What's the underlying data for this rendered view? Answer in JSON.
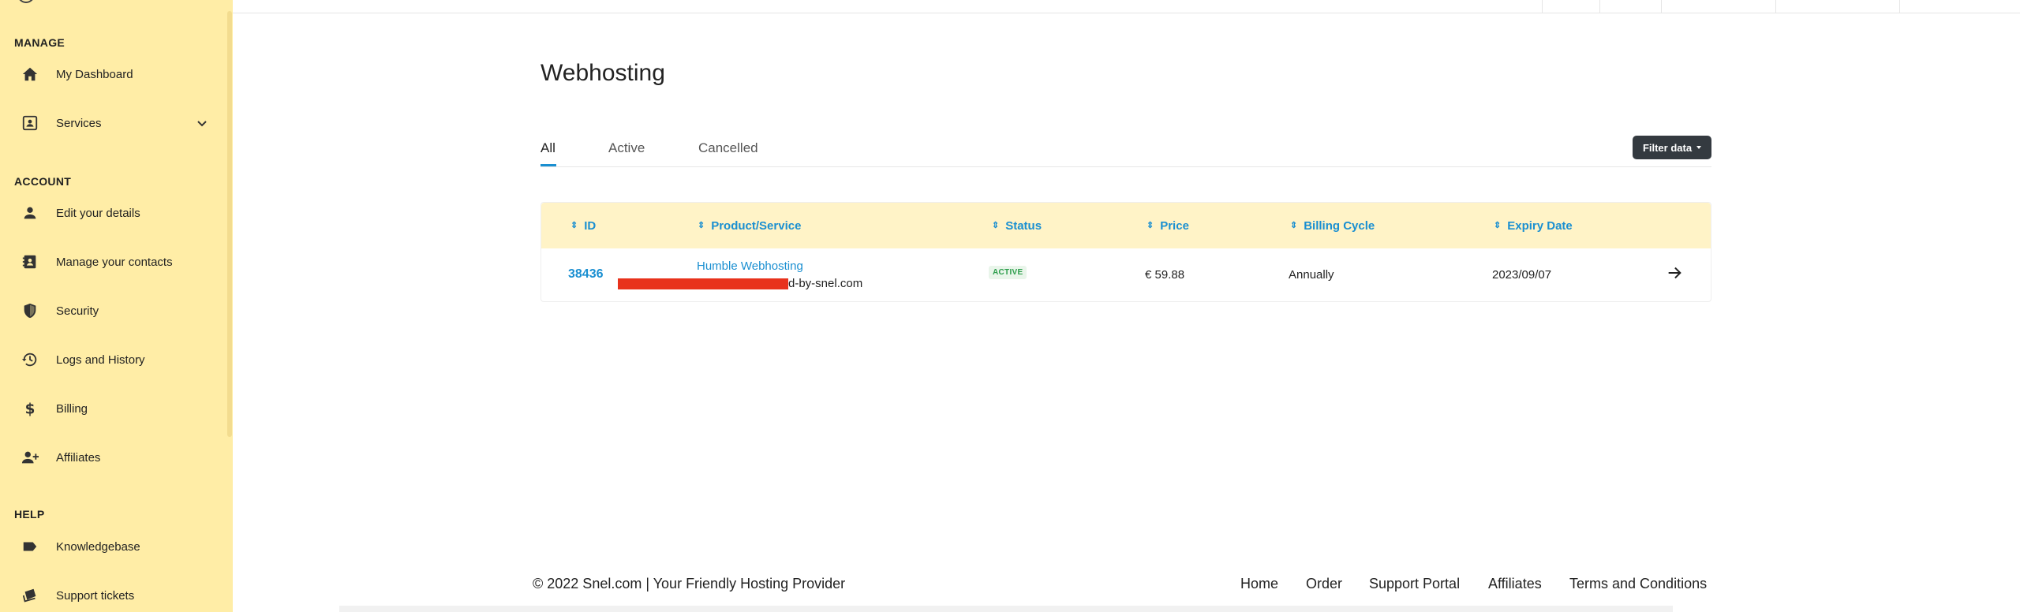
{
  "sidebar": {
    "sections": [
      {
        "title": "MANAGE"
      },
      {
        "title": "ACCOUNT"
      },
      {
        "title": "HELP"
      }
    ],
    "items": [
      {
        "label": "My Dashboard",
        "icon": "home-icon"
      },
      {
        "label": "Services",
        "icon": "contact-card-icon"
      },
      {
        "label": "Edit your details",
        "icon": "person-icon"
      },
      {
        "label": "Manage your contacts",
        "icon": "contacts-book-icon"
      },
      {
        "label": "Security",
        "icon": "shield-icon"
      },
      {
        "label": "Logs and History",
        "icon": "history-icon"
      },
      {
        "label": "Billing",
        "icon": "dollar-icon"
      },
      {
        "label": "Affiliates",
        "icon": "user-plus-icon"
      },
      {
        "label": "Knowledgebase",
        "icon": "label-icon"
      },
      {
        "label": "Support tickets",
        "icon": "ticket-icon"
      }
    ]
  },
  "main": {
    "title": "Webhosting",
    "tabs": [
      {
        "label": "All",
        "active": true
      },
      {
        "label": "Active",
        "active": false
      },
      {
        "label": "Cancelled",
        "active": false
      }
    ],
    "filter_label": "Filter data",
    "table": {
      "headers": [
        "ID",
        "Product/Service",
        "Status",
        "Price",
        "Billing Cycle",
        "Expiry Date"
      ],
      "rows": [
        {
          "id": "38436",
          "product": "Humble Webhosting",
          "domain_suffix": "d-by-snel.com",
          "status": "ACTIVE",
          "price": "€ 59.88",
          "billing_cycle": "Annually",
          "expiry": "2023/09/07"
        }
      ]
    }
  },
  "footer": {
    "copyright": "© 2022 Snel.com | Your Friendly Hosting Provider",
    "links": [
      "Home",
      "Order",
      "Support Portal",
      "Affiliates",
      "Terms and Conditions"
    ]
  },
  "colors": {
    "sidebar_bg": "#ffeda6",
    "table_header_bg": "#fff3c7",
    "accent": "#1a8fd1",
    "redaction": "#e8321c",
    "button_dark": "#343a40"
  }
}
